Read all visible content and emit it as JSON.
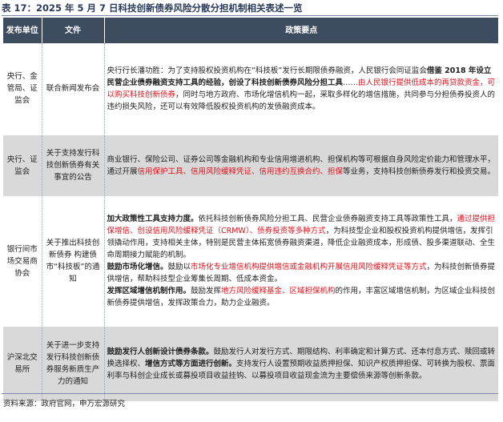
{
  "title": "表 17：2025 年 5 月 7 日科技创新债券风险分散分担机制相关表述一览",
  "headers": {
    "issuer": "发布单位",
    "document": "文件",
    "points": "政策要点"
  },
  "rows": [
    {
      "issuer": "央行、金管局、证监会",
      "document": "联合新闻发布会",
      "segments": [
        {
          "t": "央行行长潘功胜：为了支持股权投资机构在“科技板”发行长期限债券融资，人民银行会同证监会",
          "s": "n"
        },
        {
          "t": "借鉴 2018 年设立民营企业债券融资支持工具的经验，创设了科技创新债券风险分担工具",
          "s": "b"
        },
        {
          "t": "……",
          "s": "n"
        },
        {
          "t": "由人民银行提供低成本的再贷款资金，可以购买科技创新债券",
          "s": "r"
        },
        {
          "t": "，同时与地方政府、市场化增信机构一起，采取多样化的增信措施，共同参与分担债券投资人的违约损失风险，还可以有效降低股权投资机构的发债融资成本。",
          "s": "n"
        }
      ]
    },
    {
      "issuer": "央行、证监会",
      "document": "关于支持发行科技创新债券有关事宜的公告",
      "segments": [
        {
          "t": "商业银行、保险公司、证券公司等金融机构和专业信用增进机构、担保机构等可根据自身风险定价能力和管理水平，通过开展",
          "s": "n"
        },
        {
          "t": "信用保护工具、信用风险缓释凭证、信用违约互换合约、担保",
          "s": "r"
        },
        {
          "t": "等业务，支持科技创新债券发行和投资交易。",
          "s": "n"
        }
      ]
    },
    {
      "issuer": "银行间市场交易商协会",
      "document": "关于推出科技创新债券 构建债市“科技板”的通知",
      "segments": [
        {
          "t": "加大政策性工具支持力度。",
          "s": "b"
        },
        {
          "t": "依托科技创新债券风险分担工具、民营企业债券融资支持工具等政策性工具，",
          "s": "n"
        },
        {
          "t": "通过提供担保增信、创设信用风险缓释凭证（CRMW）、债券投资等多种方式",
          "s": "r"
        },
        {
          "t": "，为科技型企业和股权投资机构提供增信，发挥引领撬动作用，支持相关主体，特别是民营主体拓宽债券融资渠道，降低企业融资成本，形成债、股多渠道联动、全生命周期接力赋能的机制。",
          "s": "n"
        },
        {
          "t": "鼓励市场化增信。",
          "s": "b"
        },
        {
          "t": "鼓励以",
          "s": "n"
        },
        {
          "t": "市场化专业增信机构提供增信或金融机构开展信用风险缓释凭证等方式",
          "s": "r"
        },
        {
          "t": "，为科技创新债券提供增信，帮助科技型企业筹集长周期、低成本资金。",
          "s": "n"
        },
        {
          "t": "发挥区域增信机制作用。",
          "s": "b"
        },
        {
          "t": "鼓励发挥",
          "s": "n"
        },
        {
          "t": "地方风险缓释基金、区域担保机构",
          "s": "r"
        },
        {
          "t": "的作用，丰富区域增信机制，为区域企业科技创新债券提供增信，发挥政策合力，助力企业融资。",
          "s": "n"
        }
      ]
    },
    {
      "issuer": "沪深北交易所",
      "document": "关于进一步支持发行科技创新债券服务新质生产力的通知",
      "segments": [
        {
          "t": "鼓励发行人创新设计债券条款。",
          "s": "b"
        },
        {
          "t": "鼓励发行人对发行方式、期限结构、利率确定和计算方式、还本付息方式、赎回或转换选择权、",
          "s": "n"
        },
        {
          "t": "增信方式等方面进行创新。",
          "s": "b"
        },
        {
          "t": "支持发行人设置预期收益质押担保、知识产权质押担保、可转换为股权、票面利率与科创企业成长或募投项目收益挂钩、以募投项目收益现金流为主要偿债来源等创新条款。",
          "s": "n"
        }
      ]
    }
  ],
  "source": "资料来源：政府官网，申万宏源研究"
}
